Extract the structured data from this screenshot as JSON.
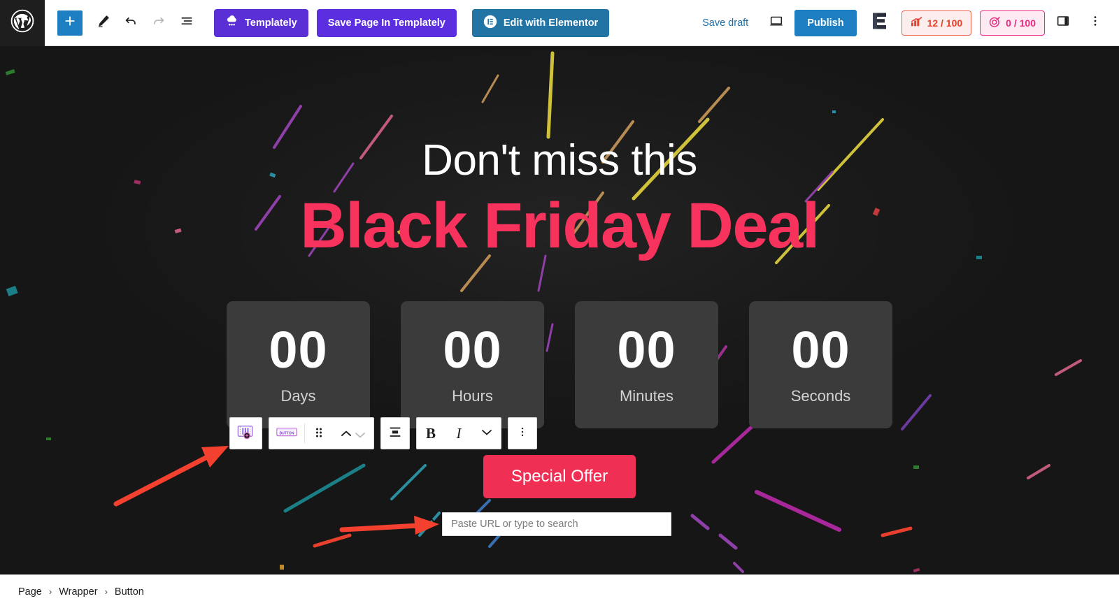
{
  "topbar": {
    "logo_icon": "wordpress-logo-icon",
    "add_block_label": "+",
    "tools": [
      {
        "name": "add-block-button",
        "icon": "plus-icon"
      },
      {
        "name": "edit-mode-button",
        "icon": "pencil-icon"
      },
      {
        "name": "undo-button",
        "icon": "undo-arrow-icon"
      },
      {
        "name": "redo-button",
        "icon": "redo-arrow-icon"
      },
      {
        "name": "list-view-button",
        "icon": "list-view-icon"
      }
    ],
    "templately_label": "Templately",
    "save_page_label": "Save Page In Templately",
    "elementor_label": "Edit with Elementor",
    "save_draft_label": "Save draft",
    "preview_icon": "preview-monitor-icon",
    "publish_label": "Publish",
    "eb_icon": "essential-blocks-icon",
    "rank_badge": "12 / 100",
    "seo_badge": "0 / 100",
    "sidebar_toggle_icon": "sidebar-toggle-icon",
    "options_icon": "kebab-menu-icon"
  },
  "hero": {
    "subtitle": "Don't miss this",
    "title": "Black Friday Deal"
  },
  "countdown": [
    {
      "value": "00",
      "label": "Days"
    },
    {
      "value": "00",
      "label": "Hours"
    },
    {
      "value": "00",
      "label": "Minutes"
    },
    {
      "value": "00",
      "label": "Seconds"
    }
  ],
  "cta": {
    "label": "Special Offer"
  },
  "link_popover": {
    "placeholder": "Paste URL or type to search",
    "value": "",
    "icon": "link-chain-icon"
  },
  "block_toolbar": {
    "insert_template_icon": "insert-template-block-icon",
    "block_type_icon": "button-block-icon",
    "drag_icon": "drag-handle-icon",
    "move_up_icon": "chevron-up-icon",
    "move_down_icon": "chevron-down-icon",
    "align_icon": "align-center-icon",
    "bold_label": "B",
    "italic_label": "I",
    "more_formats_icon": "chevron-down-icon",
    "options_icon": "kebab-menu-icon"
  },
  "breadcrumb": {
    "items": [
      "Page",
      "Wrapper",
      "Button"
    ],
    "separator": "›"
  },
  "colors": {
    "accent_pink": "#f7335d",
    "cta_red": "#ef2f53",
    "wp_blue": "#1d7ec1",
    "templately_purple": "#5a2fd6",
    "elementor_blue": "#2274a5",
    "canvas_dark": "#161616",
    "countdown_box": "#3b3b3b",
    "annotation_red": "#f4402e"
  }
}
